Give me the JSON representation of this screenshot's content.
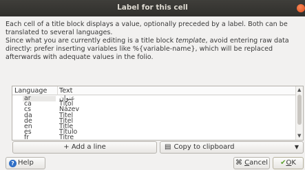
{
  "window": {
    "title": "Label for this cell"
  },
  "description": {
    "line1": "Each cell of a title block displays a value, optionally preceded by a label. Both can be translated to several languages.",
    "line2_before": "Since what you are currently editing is a title block ",
    "line2_italic": "template",
    "line2_after": ", avoid entering raw data directly: prefer inserting variables like %{variable-name}, which will be replaced afterwards with adequate values in the folio."
  },
  "table": {
    "headers": {
      "language": "Language",
      "text": "Text"
    },
    "rows": [
      {
        "lang": "ar",
        "text": "عنوان"
      },
      {
        "lang": "ca",
        "text": "Títol"
      },
      {
        "lang": "cs",
        "text": "Název"
      },
      {
        "lang": "da",
        "text": "Titel"
      },
      {
        "lang": "de",
        "text": "Titel"
      },
      {
        "lang": "en",
        "text": "Title"
      },
      {
        "lang": "es",
        "text": "Título"
      },
      {
        "lang": "fr",
        "text": "Titre"
      }
    ]
  },
  "buttons": {
    "add_line": "+ Add a line",
    "copy_clipboard": "Copy to clipboard",
    "help": "Help",
    "cancel_prefix": "",
    "cancel_underlined": "C",
    "cancel_rest": "ancel",
    "ok_underlined": "O",
    "ok_rest": "K"
  }
}
